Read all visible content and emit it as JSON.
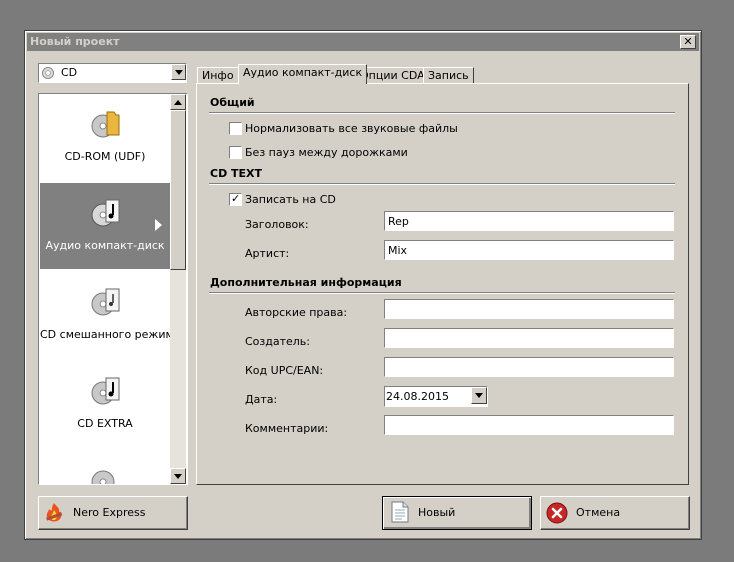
{
  "window": {
    "title": "Новый проект",
    "close_symbol": "✕"
  },
  "disc_type": {
    "value": "CD"
  },
  "projects": [
    {
      "label": "CD-ROM (UDF)",
      "icon": "cd-folder-icon",
      "selected": false
    },
    {
      "label": "Аудио компакт-диск",
      "icon": "cd-music-icon",
      "selected": true
    },
    {
      "label": "CD смешанного режима",
      "icon": "cd-mixed-icon",
      "selected": false
    },
    {
      "label": "CD EXTRA",
      "icon": "cd-extra-icon",
      "selected": false
    }
  ],
  "tabs": [
    {
      "label": "Инфо"
    },
    {
      "label": "Аудио компакт-диск",
      "active": true
    },
    {
      "label": "Опции CDA"
    },
    {
      "label": "Запись"
    }
  ],
  "general": {
    "heading": "Общий",
    "normalize_label": "Нормализовать все звуковые файлы",
    "normalize_checked": false,
    "nogap_label": "Без пауз между дорожками",
    "nogap_checked": false
  },
  "cdtext": {
    "heading": "CD TEXT",
    "write_label": "Записать на CD",
    "write_checked": true,
    "title_label": "Заголовок:",
    "title_value": "Rep",
    "artist_label": "Артист:",
    "artist_value": "Mix"
  },
  "extra": {
    "heading": "Дополнительная информация",
    "copyright_label": "Авторские права:",
    "copyright_value": "",
    "creator_label": "Создатель:",
    "creator_value": "",
    "upc_label": "Код UPC/EAN:",
    "upc_value": "",
    "date_label": "Дата:",
    "date_value": "24.08.2015",
    "comments_label": "Комментарии:",
    "comments_value": ""
  },
  "buttons": {
    "nero_express": "Nero Express",
    "new": "Новый",
    "cancel": "Отмена"
  },
  "colors": {
    "title_bar": "#808080",
    "selection": "#808080",
    "face": "#d4d0c8",
    "cancel_icon": "#c62828"
  }
}
